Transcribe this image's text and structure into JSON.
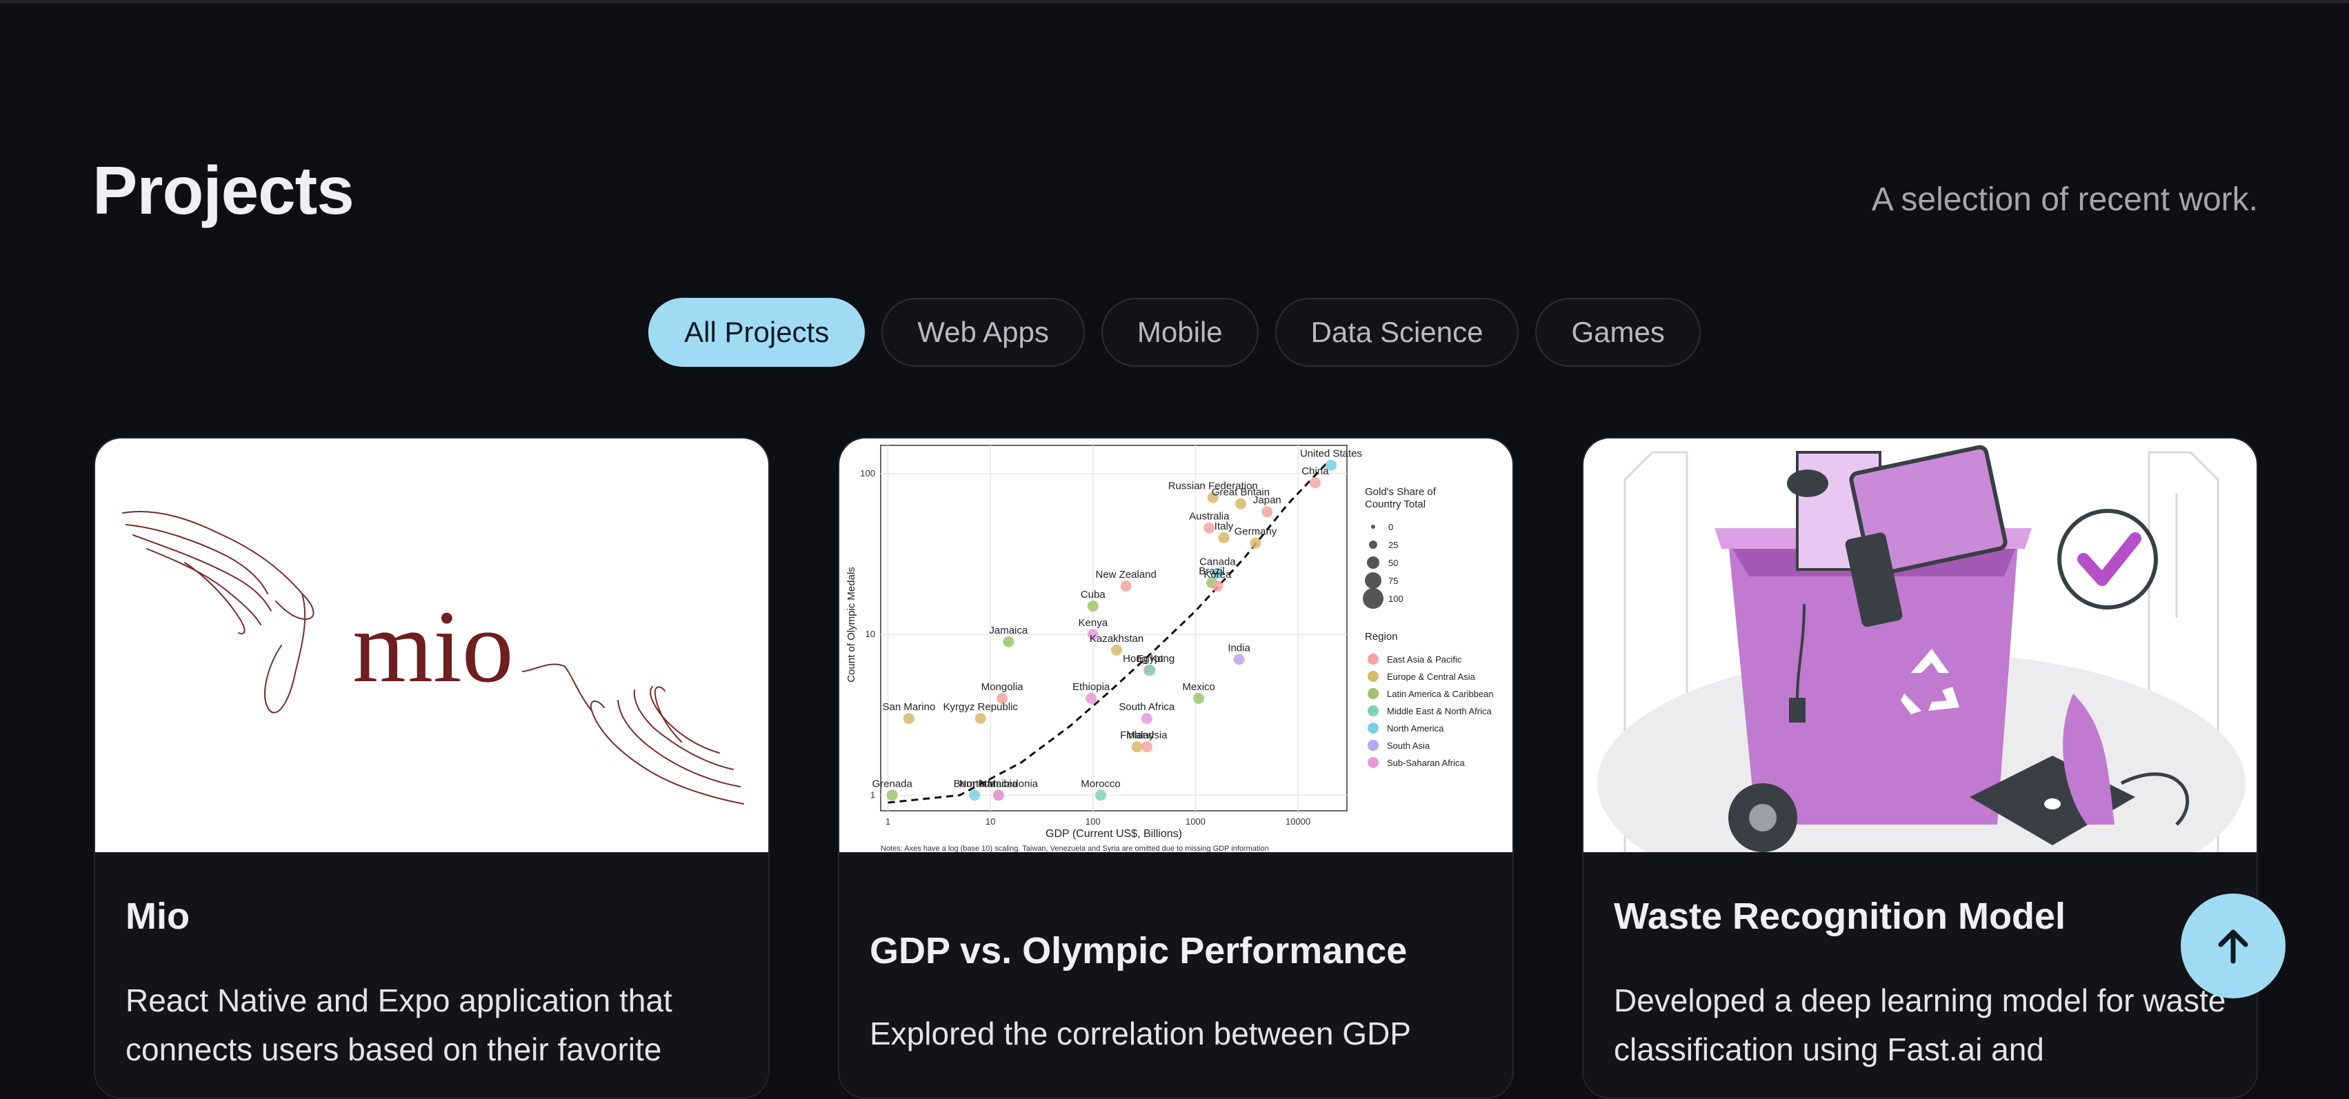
{
  "header": {
    "title": "Projects",
    "subtitle": "A selection of recent work."
  },
  "filters": [
    {
      "label": "All Projects",
      "active": true
    },
    {
      "label": "Web Apps",
      "active": false
    },
    {
      "label": "Mobile",
      "active": false
    },
    {
      "label": "Data Science",
      "active": false
    },
    {
      "label": "Games",
      "active": false
    }
  ],
  "projects": [
    {
      "title": "Mio",
      "description": "React Native and Expo application that connects users based on their favorite",
      "image": {
        "logo_text": "mio",
        "style": "hand-drawn hands reaching toward wordmark",
        "color": "#6e1f1f"
      }
    },
    {
      "title": "GDP vs. Olympic Performance",
      "description": "Explored the correlation between GDP",
      "image": {
        "chart_data": {
          "type": "scatter",
          "xlabel": "GDP (Current US$, Billions)",
          "ylabel": "Count of Olympic Medals",
          "x_scale": "log10",
          "y_scale": "log10",
          "x_ticks": [
            "1",
            "10",
            "100",
            "1000",
            "10000"
          ],
          "y_ticks": [
            "1",
            "10",
            "100"
          ],
          "note": "Notes: Axes have a log (base 10) scaling. Taiwan, Venezuela and Syria are omitted due to missing GDP information",
          "size_legend": {
            "title_line1": "Gold's Share of",
            "title_line2": "Country Total",
            "values": [
              "0",
              "25",
              "50",
              "75",
              "100"
            ]
          },
          "region_legend": {
            "title": "Region",
            "items": [
              {
                "name": "East Asia & Pacific",
                "color": "#f4a3a3"
              },
              {
                "name": "Europe & Central Asia",
                "color": "#d8b86a"
              },
              {
                "name": "Latin America & Caribbean",
                "color": "#9cc46a"
              },
              {
                "name": "Middle East & North Africa",
                "color": "#7fd3b3"
              },
              {
                "name": "North America",
                "color": "#79cfe8"
              },
              {
                "name": "South Asia",
                "color": "#b9a6f2"
              },
              {
                "name": "Sub-Saharan Africa",
                "color": "#e49ad9"
              }
            ]
          },
          "points": [
            {
              "label": "United States",
              "x": 21000,
              "y": 113,
              "region": 4
            },
            {
              "label": "China",
              "x": 14700,
              "y": 88,
              "region": 0
            },
            {
              "label": "Russian Federation",
              "x": 1480,
              "y": 71,
              "region": 1
            },
            {
              "label": "Great Britain",
              "x": 2760,
              "y": 65,
              "region": 1
            },
            {
              "label": "Japan",
              "x": 5000,
              "y": 58,
              "region": 0
            },
            {
              "label": "Australia",
              "x": 1360,
              "y": 46,
              "region": 0
            },
            {
              "label": "Germany",
              "x": 3850,
              "y": 37,
              "region": 1
            },
            {
              "label": "Italy",
              "x": 1890,
              "y": 40,
              "region": 1
            },
            {
              "label": "Canada",
              "x": 1640,
              "y": 24,
              "region": 4
            },
            {
              "label": "Brazil",
              "x": 1440,
              "y": 21,
              "region": 2
            },
            {
              "label": "New Zealand",
              "x": 210,
              "y": 20,
              "region": 0
            },
            {
              "label": "Korea",
              "x": 1640,
              "y": 20,
              "region": 0
            },
            {
              "label": "Cuba",
              "x": 100,
              "y": 15,
              "region": 2
            },
            {
              "label": "Kenya",
              "x": 100,
              "y": 10,
              "region": 6
            },
            {
              "label": "Jamaica",
              "x": 15,
              "y": 9,
              "region": 2
            },
            {
              "label": "Kazakhstan",
              "x": 170,
              "y": 8,
              "region": 1
            },
            {
              "label": "India",
              "x": 2660,
              "y": 7,
              "region": 5
            },
            {
              "label": "Hong Kong",
              "x": 350,
              "y": 6,
              "region": 0
            },
            {
              "label": "Egypt",
              "x": 360,
              "y": 6,
              "region": 3
            },
            {
              "label": "Mongolia",
              "x": 13,
              "y": 4,
              "region": 0
            },
            {
              "label": "Ethiopia",
              "x": 96,
              "y": 4,
              "region": 6
            },
            {
              "label": "South Africa",
              "x": 335,
              "y": 3,
              "region": 6
            },
            {
              "label": "Mexico",
              "x": 1076,
              "y": 4,
              "region": 2
            },
            {
              "label": "San Marino",
              "x": 1.6,
              "y": 3,
              "region": 1
            },
            {
              "label": "Kyrgyz Republic",
              "x": 8,
              "y": 3,
              "region": 1
            },
            {
              "label": "Malaysia",
              "x": 336,
              "y": 2,
              "region": 0
            },
            {
              "label": "Finland",
              "x": 269,
              "y": 2,
              "region": 1
            },
            {
              "label": "Grenada",
              "x": 1.1,
              "y": 1,
              "region": 2
            },
            {
              "label": "North Macedonia",
              "x": 12,
              "y": 1,
              "region": 1
            },
            {
              "label": "Bermuda",
              "x": 7,
              "y": 1,
              "region": 4
            },
            {
              "label": "Namibia",
              "x": 12,
              "y": 1,
              "region": 6
            },
            {
              "label": "Morocco",
              "x": 119,
              "y": 1,
              "region": 3
            }
          ],
          "trend": [
            [
              1,
              0.9
            ],
            [
              5,
              1.0
            ],
            [
              20,
              1.6
            ],
            [
              60,
              2.7
            ],
            [
              150,
              4.5
            ],
            [
              400,
              8
            ],
            [
              1000,
              14
            ],
            [
              3000,
              30
            ],
            [
              8000,
              65
            ],
            [
              20000,
              120
            ]
          ]
        }
      }
    },
    {
      "title": "Waste Recognition Model",
      "description": "Developed a deep learning model for waste classification using Fast.ai and",
      "image": {
        "style": "isometric illustration of purple recycling bin with electronics",
        "accent": "#c07ad0"
      }
    }
  ],
  "fab": {
    "icon": "arrow-up-icon"
  }
}
